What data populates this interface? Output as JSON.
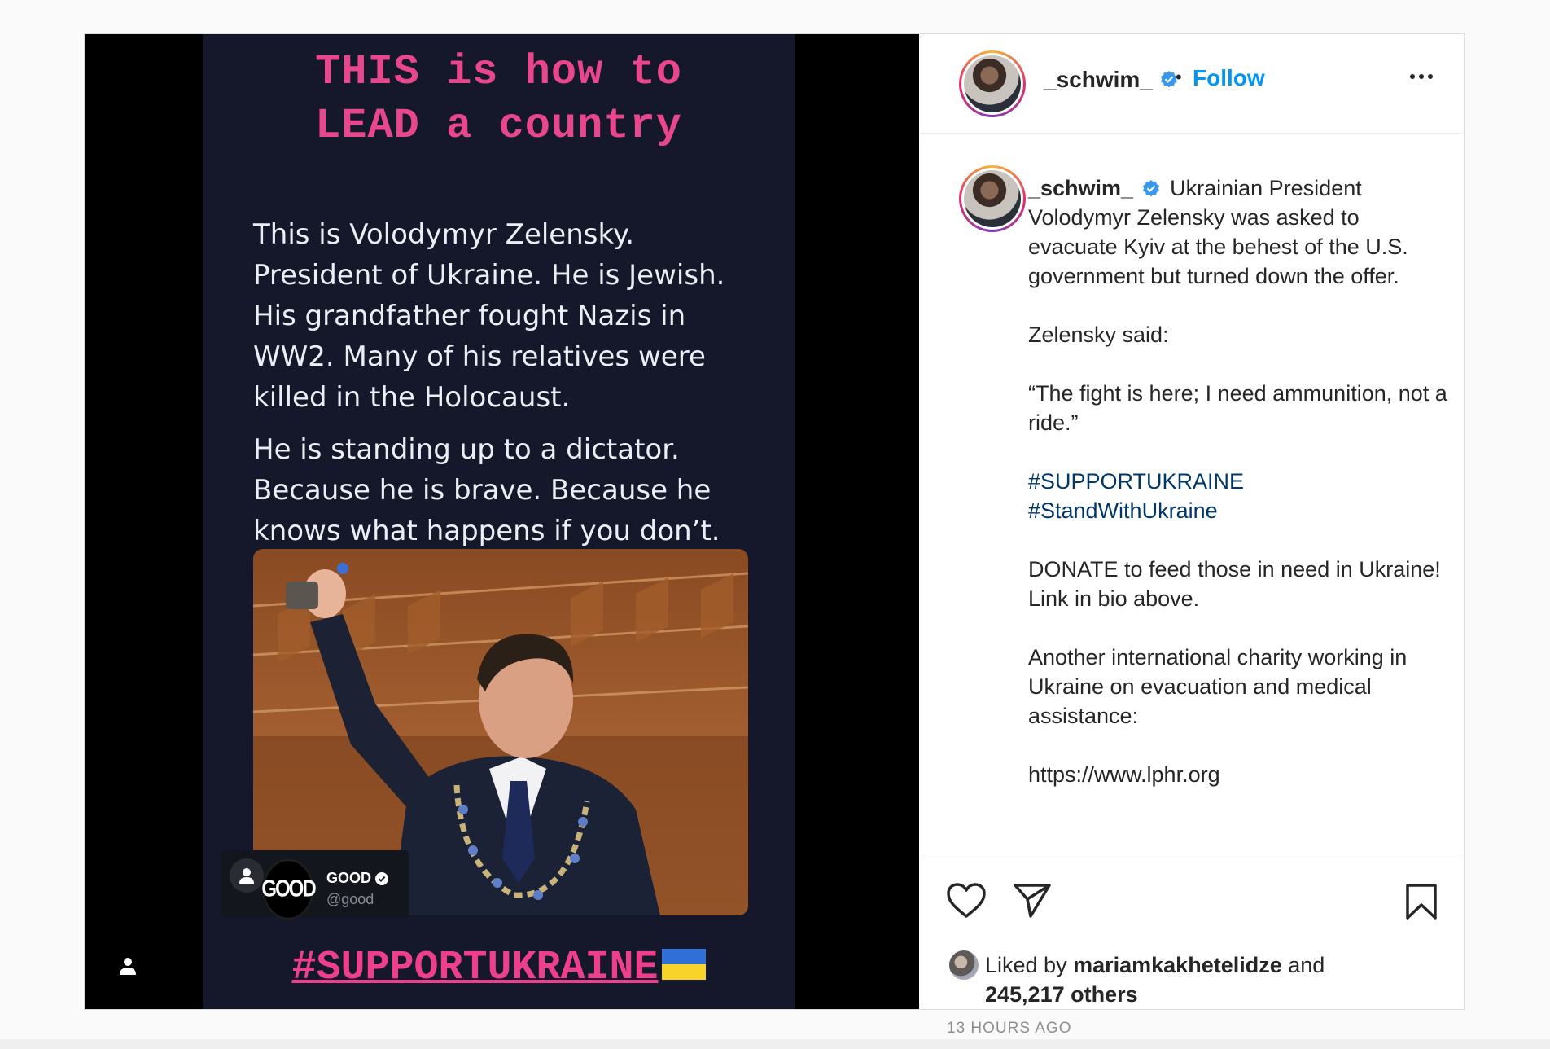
{
  "media": {
    "title_line1": "THIS is how to",
    "title_line2": "LEAD a country",
    "paragraph1": "This is Volodymyr Zelensky. President of Ukraine. He is Jewish. His grandfather fought Nazis in WW2. Many of his relatives were killed in the Holocaust.",
    "paragraph2": "He is standing up to a dictator. Because he is brave. Because he knows what happens if you don’t.",
    "attribution_logo": "GOOD",
    "attribution_name": "GOOD",
    "attribution_handle": "@good",
    "banner_hashtag": "#SUPPORTUKRAINE",
    "user_tag_icon": "person-icon"
  },
  "header": {
    "username": "_schwim_",
    "separator": "•",
    "follow_label": "Follow",
    "more_icon": "more-icon"
  },
  "caption": {
    "username": "_schwim_",
    "text1": "Ukrainian President Volodymyr Zelensky was asked to evacuate Kyiv at the behest of the U.S. government but turned down the offer.",
    "text2": "Zelensky said:",
    "text3": "“The fight is here; I need ammunition, not a ride.”",
    "hashtag1": "#SUPPORTUKRAINE",
    "hashtag2": "#StandWithUkraine",
    "text4": "DONATE to feed those in need in Ukraine! Link in bio above.",
    "text5": "Another international charity working in Ukraine on evacuation and medical assistance:",
    "link": "https://www.lphr.org"
  },
  "actions": {
    "like_icon": "heart-icon",
    "share_icon": "send-icon",
    "save_icon": "bookmark-icon",
    "liked_by_prefix": "Liked by",
    "liked_by_user": "mariamkakhetelidze",
    "liked_by_and": "and",
    "others_count": "245,217 others",
    "timestamp": "13 HOURS AGO"
  },
  "colors": {
    "follow": "#0095f6",
    "hashtag": "#00376b",
    "verified": "#3897f0",
    "card_title": "#e8478d"
  }
}
